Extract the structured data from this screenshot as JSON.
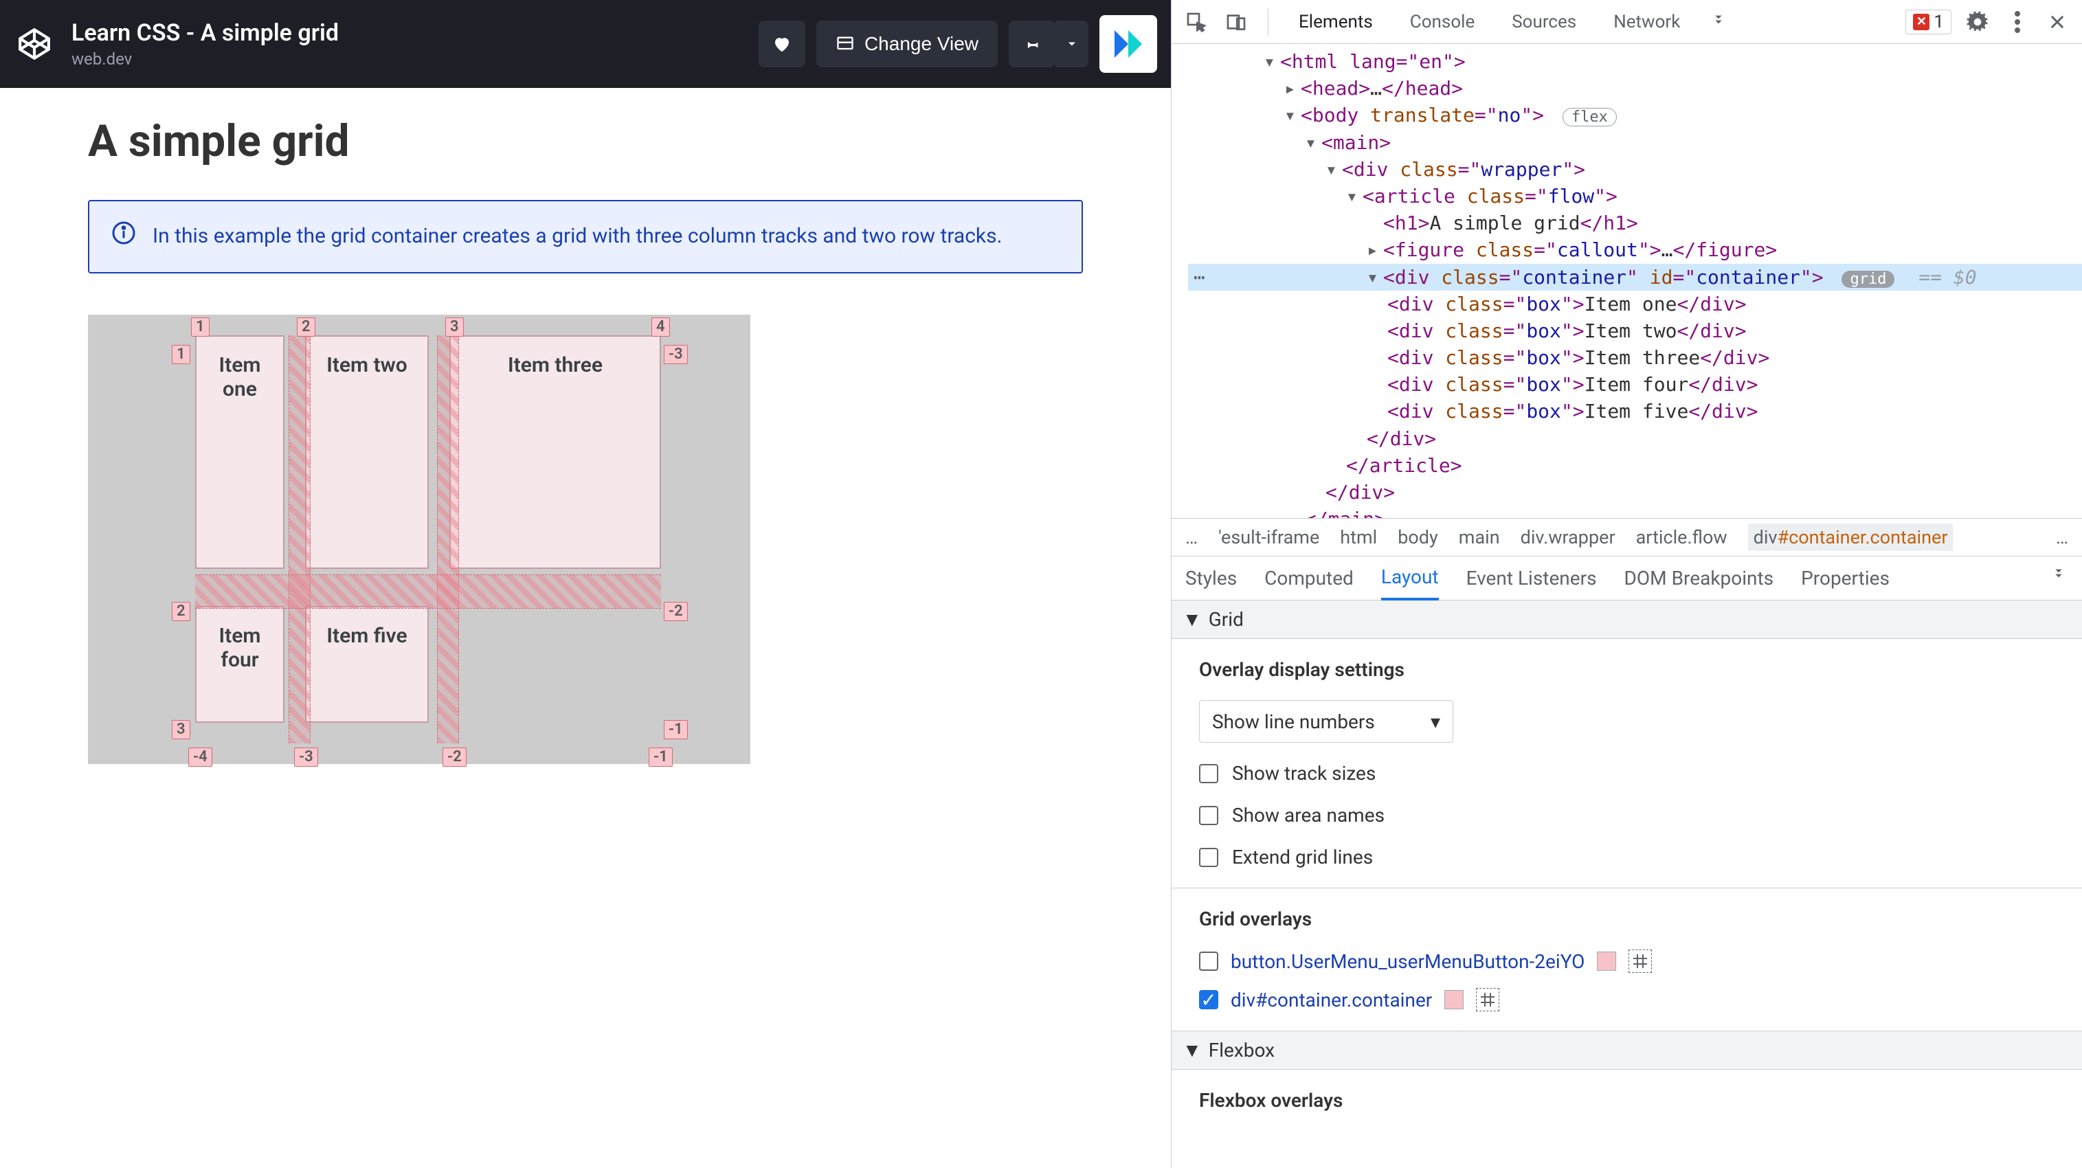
{
  "codepen": {
    "title": "Learn CSS - A simple grid",
    "subtitle": "web.dev",
    "changeViewLabel": "Change View"
  },
  "page": {
    "heading": "A simple grid",
    "calloutText": "In this example the grid container creates a grid with three column tracks and two row tracks.",
    "gridItems": [
      "Item one",
      "Item two",
      "Item three",
      "Item four",
      "Item five"
    ],
    "colLabelsTop": [
      "1",
      "2",
      "3",
      "4"
    ],
    "rowLabelsLeft": [
      "1",
      "2",
      "3"
    ],
    "rowLabelsRight": [
      "-3",
      "-2",
      "-1"
    ],
    "colLabelsBottom": [
      "-4",
      "-3",
      "-2",
      "-1"
    ]
  },
  "devtools": {
    "topTabs": [
      "Elements",
      "Console",
      "Sources",
      "Network"
    ],
    "errorCount": "1",
    "dom": {
      "htmlOpen": "<html lang=\"en\">",
      "headOpen": "<head>",
      "headClose": "</head>",
      "ellipsis": "…",
      "bodyOpenA": "<body ",
      "bodyTranslateAttr": "translate",
      "bodyTranslateVal": "no",
      "bodyOpenB": ">",
      "flexBadge": "flex",
      "mainOpen": "<main>",
      "divWrapperOpenA": "<div ",
      "classAttr": "class",
      "wrapperVal": "wrapper",
      "tagCloseGt": ">",
      "articleFlowVal": "flow",
      "h1OpenClose": "<h1>",
      "h1Text": "A simple grid",
      "h1End": "</h1>",
      "figureCalloutVal": "callout",
      "figureEnd": "</figure>",
      "containerVal": "container",
      "idAttr": "id",
      "gridBadge": "grid",
      "eqZero": "== $0",
      "boxVal": "box",
      "boxTexts": [
        "Item one",
        "Item two",
        "Item three",
        "Item four",
        "Item five"
      ],
      "divEnd": "</div>",
      "articleEnd": "</article>",
      "mainEnd": "</main>"
    },
    "breadcrumbs": {
      "more": "…",
      "items": [
        "'esult-iframe",
        "html",
        "body",
        "main",
        "div.wrapper",
        "article.flow"
      ],
      "activePrefix": "div",
      "activeSuffix": "#container.container"
    },
    "lowerTabs": [
      "Styles",
      "Computed",
      "Layout",
      "Event Listeners",
      "DOM Breakpoints",
      "Properties"
    ],
    "gridSection": {
      "header": "Grid",
      "overlayTitle": "Overlay display settings",
      "dropdownValue": "Show line numbers",
      "checkboxes": [
        "Show track sizes",
        "Show area names",
        "Extend grid lines"
      ],
      "gridOverlaysTitle": "Grid overlays",
      "overlays": [
        {
          "name": "button.UserMenu_userMenuButton-2eiYO",
          "checked": false
        },
        {
          "name": "div#container.container",
          "checked": true
        }
      ]
    },
    "flexSection": {
      "header": "Flexbox",
      "overlaysTitle": "Flexbox overlays"
    }
  }
}
